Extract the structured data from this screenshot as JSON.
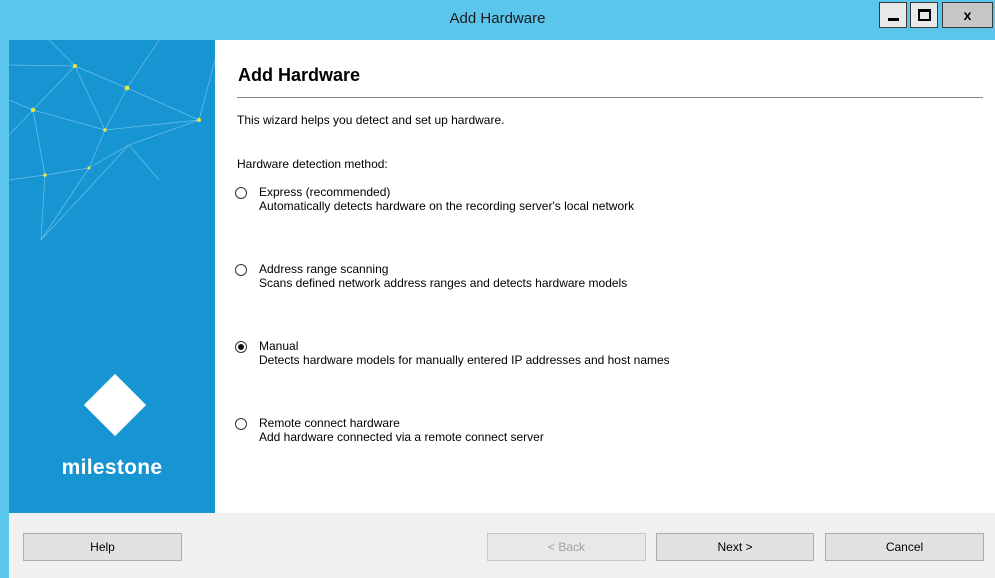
{
  "window": {
    "title": "Add Hardware",
    "controls": {
      "minimize": "minimize",
      "maximize": "maximize",
      "close": "x"
    }
  },
  "sidebar": {
    "brand": "milestone"
  },
  "main": {
    "heading": "Add Hardware",
    "intro": "This wizard helps you detect and set up hardware.",
    "method_label": "Hardware detection method:",
    "options": [
      {
        "title": "Express (recommended)",
        "description": "Automatically detects hardware on the recording server's local network",
        "checked": false
      },
      {
        "title": "Address range scanning",
        "description": "Scans defined network address ranges and detects hardware models",
        "checked": false
      },
      {
        "title": "Manual",
        "description": "Detects hardware models for manually entered IP addresses and host names",
        "checked": true
      },
      {
        "title": "Remote connect hardware",
        "description": "Add hardware connected via a remote connect server",
        "checked": false
      }
    ]
  },
  "footer": {
    "help": "Help",
    "back": "< Back",
    "next": "Next >",
    "cancel": "Cancel"
  },
  "colors": {
    "titlebar": "#5bc6ec",
    "sidebar": "#1795d2",
    "node": "#f2e13a"
  }
}
